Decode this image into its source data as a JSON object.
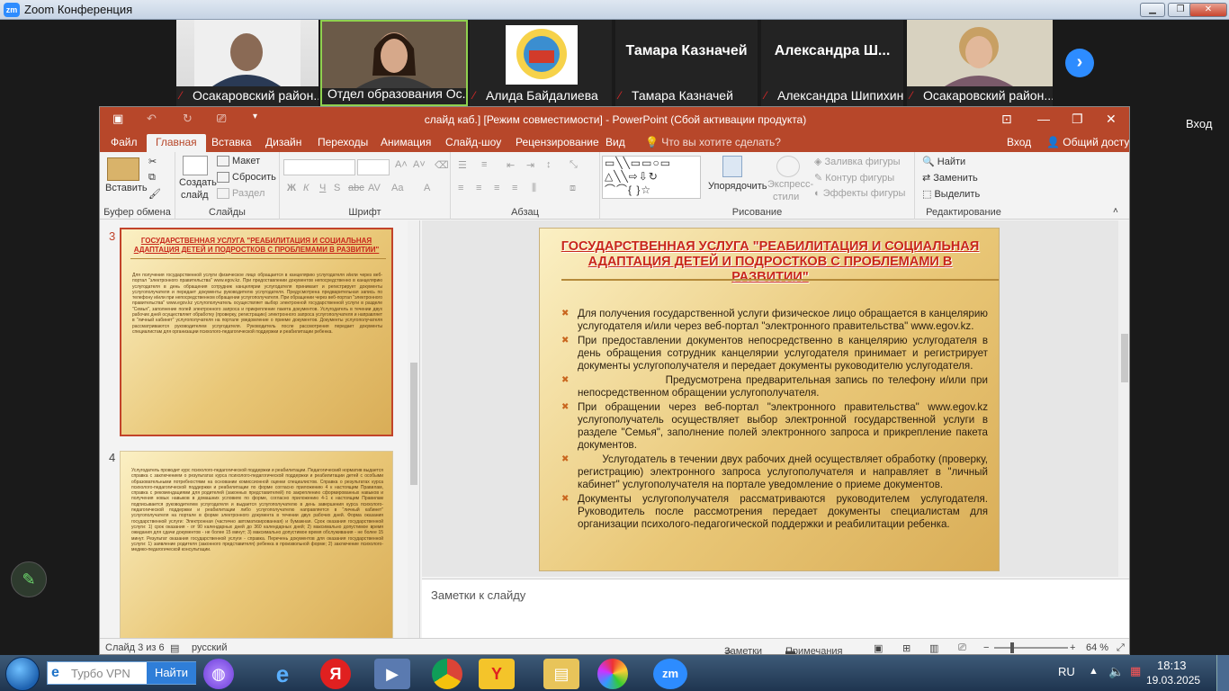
{
  "zoom": {
    "title": "Zoom Конференция",
    "logo": "zm",
    "minimize": "▁",
    "restore": "❐",
    "close": "✕"
  },
  "gallery": {
    "participants": [
      {
        "name": "Осакаровский район...",
        "video": true
      },
      {
        "name": "Отдел образования Ос...",
        "video": true,
        "active": true
      },
      {
        "name": "Алида Байдалиева",
        "video": true
      },
      {
        "name": "Тамара Казначей",
        "big": "Тамара Казначей"
      },
      {
        "name": "Александра Шипихина",
        "big": "Александра Ш..."
      },
      {
        "name": "Осакаровский район...",
        "video": true
      }
    ],
    "next_arrow": "›"
  },
  "vhod_side": "Вход",
  "ppt": {
    "title": "слайд каб.] [Режим совместимости] - PowerPoint (Сбой активации продукта)",
    "tabs": [
      "Файл",
      "Главная",
      "Вставка",
      "Дизайн",
      "Переходы",
      "Анимация",
      "Слайд-шоу",
      "Рецензирование",
      "Вид",
      "Что вы хотите сделать?"
    ],
    "login": "Вход",
    "share": "Общий доступ",
    "ribbon": {
      "clipboard": {
        "label": "Буфер обмена",
        "paste": "Вставить"
      },
      "slides": {
        "label": "Слайды",
        "create": "Создать",
        "create2": "слайд",
        "layout": "Макет",
        "reset": "Сбросить",
        "section": "Раздел"
      },
      "font": {
        "label": "Шрифт",
        "bold": "Ж",
        "italic": "К",
        "underline": "Ч",
        "strike": "S",
        "shadow": "abc",
        "spacing": "AV",
        "case": "Aa",
        "color": "A"
      },
      "paragraph": {
        "label": "Абзац"
      },
      "drawing": {
        "label": "Рисование",
        "arrange": "Упорядочить",
        "styles": "Экспресс-",
        "styles2": "стили",
        "fill": "Заливка фигуры",
        "outline": "Контур фигуры",
        "effects": "Эффекты фигуры"
      },
      "editing": {
        "label": "Редактирование",
        "find": "Найти",
        "replace": "Заменить",
        "select": "Выделить"
      }
    },
    "thumbs": {
      "s3": {
        "num": "3",
        "title": "ГОСУДАРСТВЕННАЯ УСЛУГА \"РЕАБИЛИТАЦИЯ И СОЦИАЛЬНАЯ АДАПТАЦИЯ ДЕТЕЙ И ПОДРОСТКОВ С ПРОБЛЕМАМИ В РАЗВИТИИ\"",
        "text": "Для получения государственной услуги физическое лицо обращается в канцелярию услугодателя и/или через веб-портал \"электронного правительства\" www.egov.kz. При предоставлении документов непосредственно в канцелярию услугодателя в день обращения сотрудник канцелярии услугодателя принимает и регистрирует документы услугополучателя и передает документы руководителю услугодателя. Предусмотрена предварительная запись по телефону и/или при непосредственном обращении услугополучателя. При обращении через веб-портал \"электронного правительства\" www.egov.kz услугополучатель осуществляет выбор электронной государственной услуги в разделе \"Семья\", заполнение полей электронного запроса и прикрепление пакета документов. Услугодатель в течении двух рабочих дней осуществляет обработку (проверку, регистрацию) электронного запроса услугополучателя и направляет в \"личный кабинет\" услугополучателя на портале уведомление о приеме документов. Документы услугополучателя рассматриваются руководителем услугодателя. Руководитель после рассмотрения передает документы специалистам для организации психолого-педагогической поддержки и реабилитации ребенка."
      },
      "s4": {
        "num": "4",
        "text": "Услугодатель проводит курс психолого-педагогической поддержки и реабилитации. Педагогический норматив выдается справка с заключением о результатах курса психолого-педагогической поддержки и реабилитации детей с особыми образовательными потребностями на основании комиссионной оценки специалистов. Справка о результатах курса психолого-педагогической поддержки и реабилитации по форме согласно приложению 4 к настоящим Правилам, справка с рекомендациями для родителей (законных представителей) по закреплению сформированных навыков и получения новых навыков в домашних условиях по форме, согласно приложению 4-1 к настоящим Правилам подписывается руководителем услугодателя и выдается услугополучателю в день завершения курса психолого-педагогической поддержки и реабилитации либо услугополучателю направляется в \"личный кабинет\" услугополучателя на портале в форме электронного документа в течении двух рабочих дней. Форма оказания государственной услуги: Электронная (частично автоматизированная) и бумажная. Срок оказания государственной услуги: 1) срок оказания - от 90 календарных дней до 360 календарных дней; 2) максимально допустимое время ожидания для сдачи документов - не более 15 минут; 3) максимально допустимое время обслуживания - не более 15 минут. Результат оказания государственной услуги - справка. Перечень документов для оказания государственной услуги: 1) заявление родителя (законного представителя) ребенка в произвольной форме; 2) заключение психолого-медико-педагогической консультации."
      }
    },
    "slide": {
      "title": "ГОСУДАРСТВЕННАЯ  УСЛУГА \"РЕАБИЛИТАЦИЯ И СОЦИАЛЬНАЯ АДАПТАЦИЯ ДЕТЕЙ И ПОДРОСТКОВ С ПРОБЛЕМАМИ В РАЗВИТИИ\"",
      "bullets": [
        "Для получения государственной услуги физическое лицо обращается в канцелярию услугодателя и/или через веб-портал \"электронного правительства\" www.egov.kz.",
        "При предоставлении документов непосредственно в канцелярию услугодателя в день обращения сотрудник канцелярии услугодателя принимает и регистрирует документы услугополучателя и передает документы руководителю услугодателя.",
        "                    Предусмотрена предварительная запись по телефону и/или при непосредственном обращении услугополучателя.",
        "При обращении через веб-портал \"электронного правительства\" www.egov.kz услугополучатель осуществляет выбор электронной государственной услуги в разделе \"Семья\", заполнение полей электронного запроса и прикрепление пакета документов.",
        "        Услугодатель в течении двух рабочих дней осуществляет обработку (проверку, регистрацию) электронного запроса услугополучателя и направляет в \"личный кабинет\" услугополучателя на портале уведомление о приеме документов.",
        "Документы услугополучателя рассматриваются руководителем услугодателя. Руководитель после рассмотрения передает документы специалистам для организации психолого-педагогической поддержки и реабилитации ребенка."
      ]
    },
    "notes": "Заметки к слайду",
    "status": {
      "slide": "Слайд 3 из 6",
      "lang": "русский",
      "notes": "Заметки",
      "comments": "Примечания",
      "zoom": "64 %"
    }
  },
  "taskbar": {
    "search_value": "Турбо VPN",
    "search_btn": "Найти",
    "lang": "RU",
    "time": "18:13",
    "date": "19.03.2025"
  },
  "colors": {
    "ppt_red": "#b7472a",
    "zoom_blue": "#2d8cff",
    "slide_title": "#c8261b"
  }
}
